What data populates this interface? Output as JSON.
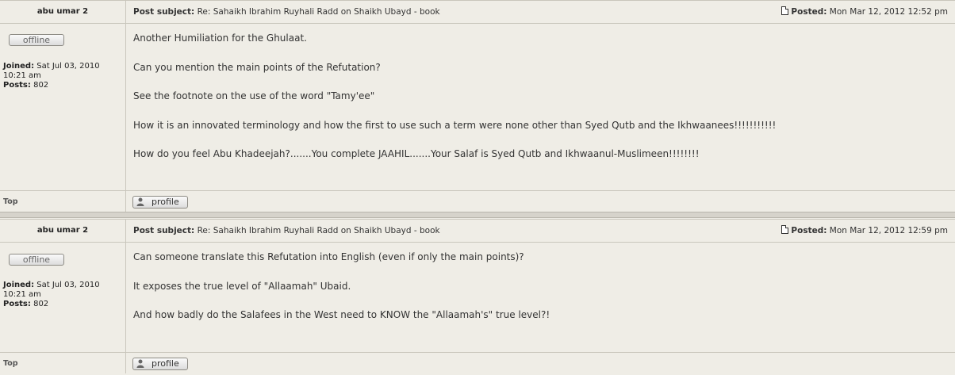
{
  "posts": [
    {
      "author": "abu umar 2",
      "subject_label": "Post subject:",
      "subject": "Re: Sahaikh Ibrahim Ruyhali Radd on Shaikh Ubayd - book",
      "posted_label": "Posted:",
      "posted": "Mon Mar 12, 2012 12:52 pm",
      "status": "offline",
      "joined_label": "Joined:",
      "joined": "Sat Jul 03, 2010",
      "joined_time": "10:21 am",
      "posts_label": "Posts:",
      "posts_count": "802",
      "body": [
        "Another Humiliation for the Ghulaat.",
        "Can you mention the main points of the Refutation?",
        "See the footnote on the use of the word \"Tamy'ee\"",
        "How it is an innovated terminology and how the first to use such a term were none other than Syed Qutb and the Ikhwaanees!!!!!!!!!!!",
        "How do you feel Abu Khadeejah?.......You complete JAAHIL.......Your Salaf is Syed Qutb and Ikhwaanul-Muslimeen!!!!!!!!"
      ],
      "top_link": "Top",
      "profile_label": "profile"
    },
    {
      "author": "abu umar 2",
      "subject_label": "Post subject:",
      "subject": "Re: Sahaikh Ibrahim Ruyhali Radd on Shaikh Ubayd - book",
      "posted_label": "Posted:",
      "posted": "Mon Mar 12, 2012 12:59 pm",
      "status": "offline",
      "joined_label": "Joined:",
      "joined": "Sat Jul 03, 2010",
      "joined_time": "10:21 am",
      "posts_label": "Posts:",
      "posts_count": "802",
      "body": [
        "Can someone translate this Refutation into English (even if only the main points)?",
        "It exposes the true level of \"Allaamah\" Ubaid.",
        "And how badly do the Salafees in the West need to KNOW the \"Allaamah's\" true level?!"
      ],
      "top_link": "Top",
      "profile_label": "profile"
    }
  ],
  "icons": {
    "post": "document-icon",
    "profile": "user-icon"
  }
}
